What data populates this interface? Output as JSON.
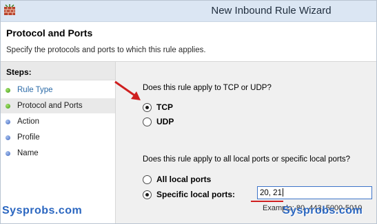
{
  "window": {
    "title": "New Inbound Rule Wizard",
    "app_icon": "firewall-brick-icon"
  },
  "header": {
    "title": "Protocol and Ports",
    "subtitle": "Specify the protocols and ports to which this rule applies."
  },
  "steps": {
    "heading": "Steps:",
    "items": [
      {
        "label": "Rule Type",
        "state": "done",
        "style": "link"
      },
      {
        "label": "Protocol and Ports",
        "state": "done",
        "style": "plain",
        "selected": true
      },
      {
        "label": "Action",
        "state": "pending",
        "style": "plain"
      },
      {
        "label": "Profile",
        "state": "pending",
        "style": "plain"
      },
      {
        "label": "Name",
        "state": "pending",
        "style": "plain"
      }
    ]
  },
  "protocol": {
    "question": "Does this rule apply to TCP or UDP?",
    "options": [
      "TCP",
      "UDP"
    ],
    "selected": "TCP"
  },
  "ports": {
    "question": "Does this rule apply to all local ports or specific local ports?",
    "options": [
      "All local ports",
      "Specific local ports:"
    ],
    "selected": "Specific local ports:",
    "value": "20, 21",
    "example": "Example: 80, 443, 5000-5010"
  },
  "watermark": "Sysprobs.com",
  "colors": {
    "titlebar": "#dbe6f3",
    "step_link": "#2a6aa7",
    "step_done": "#3f9b16",
    "step_pending": "#3f67c2",
    "annotation": "#cf1f1f",
    "watermark": "#2a66c0"
  }
}
